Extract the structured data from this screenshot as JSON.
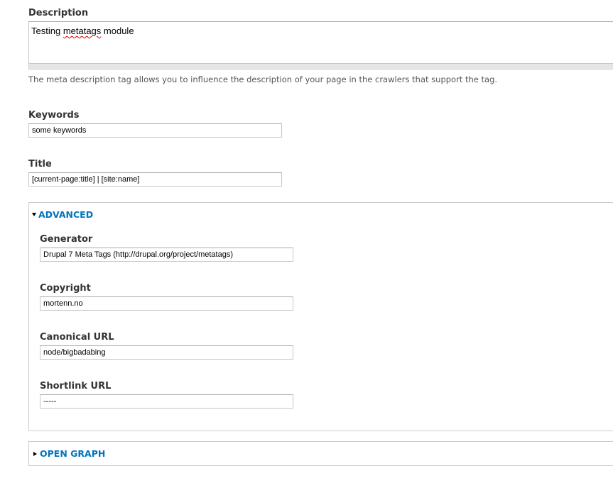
{
  "description": {
    "label": "Description",
    "value_prefix": "Testing ",
    "value_misspelled": "metatags",
    "value_suffix": " module",
    "help": "The meta description tag allows you to influence the description of your page in the crawlers that support the tag."
  },
  "keywords": {
    "label": "Keywords",
    "value": "some keywords"
  },
  "title": {
    "label": "Title",
    "value": "[current-page:title] | [site:name]"
  },
  "advanced": {
    "legend": "ADVANCED",
    "expanded": true,
    "generator": {
      "label": "Generator",
      "value": "Drupal 7 Meta Tags (http://drupal.org/project/metatags)"
    },
    "copyright": {
      "label": "Copyright",
      "value": "mortenn.no"
    },
    "canonical": {
      "label": "Canonical URL",
      "value": "node/bigbadabing"
    },
    "shortlink": {
      "label": "Shortlink URL",
      "value": "-----"
    }
  },
  "open_graph": {
    "legend": "OPEN GRAPH",
    "expanded": false
  },
  "colors": {
    "link": "#0074bd",
    "border": "#cccccc",
    "help_text": "#555555"
  }
}
